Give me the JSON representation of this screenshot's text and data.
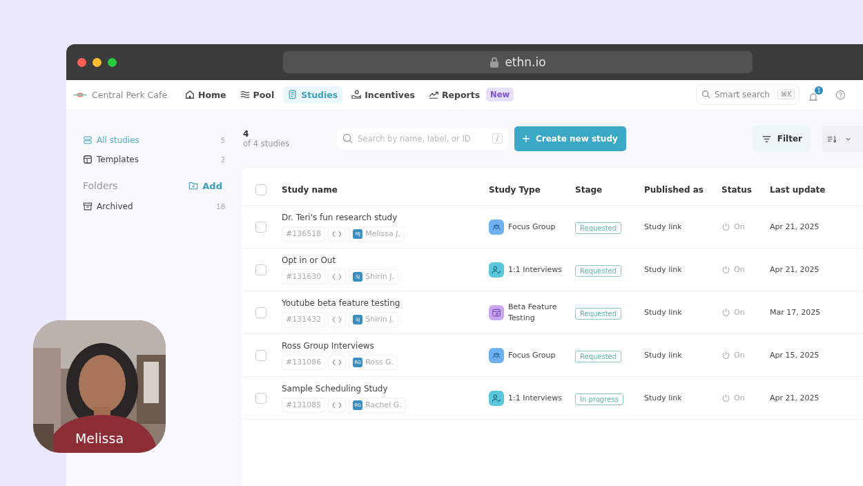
{
  "browser": {
    "url": "ethn.io"
  },
  "nav": {
    "brand": "Central Perk Cafe",
    "items": [
      {
        "label": "Home",
        "kind": "home",
        "selected": false
      },
      {
        "label": "Pool",
        "kind": "pool",
        "selected": false
      },
      {
        "label": "Studies",
        "kind": "studies",
        "selected": true
      },
      {
        "label": "Incentives",
        "kind": "incentives",
        "selected": false
      },
      {
        "label": "Reports",
        "kind": "reports",
        "selected": false,
        "badge": "New"
      }
    ],
    "search": {
      "placeholder": "Smart search",
      "shortcut": "⌘K"
    },
    "notifications": "1"
  },
  "sidebar": {
    "items": [
      {
        "label": "All studies",
        "count": "5",
        "kind": "stack",
        "selected": true
      },
      {
        "label": "Templates",
        "count": "2",
        "kind": "template",
        "selected": false
      }
    ],
    "folders_title": "Folders",
    "add": "Add",
    "folders": [
      {
        "label": "Archived",
        "count": "18"
      }
    ]
  },
  "summary": {
    "count": "4",
    "of": "of 4 studies"
  },
  "search": {
    "placeholder": "Search by name, label, or ID",
    "shortcut": "/"
  },
  "create_button": "Create new study",
  "filter_button": "Filter",
  "table": {
    "columns": [
      "Study name",
      "Study Type",
      "Stage",
      "Published as",
      "Status",
      "Last update"
    ],
    "all_checked": false,
    "rows": [
      {
        "checked": false,
        "name": "Dr. Teri's fun research study",
        "id": "#136518",
        "initials": "MJ",
        "owner": "Melissa J.",
        "kind": "focus",
        "type": "Focus Group",
        "stage": "Requested",
        "published": "Study link",
        "on": true,
        "status": "On",
        "updated": "Apr 21, 2025"
      },
      {
        "checked": false,
        "name": "Opt in or Out",
        "id": "#131630",
        "initials": "SJ",
        "owner": "Shirin J.",
        "kind": "interview",
        "type": "1:1 Interviews",
        "stage": "Requested",
        "published": "Study link",
        "on": true,
        "status": "On",
        "updated": "Apr 21, 2025"
      },
      {
        "checked": false,
        "name": "Youtube beta feature testing",
        "id": "#131432",
        "initials": "SJ",
        "owner": "Shirin J.",
        "kind": "beta",
        "type": "Beta Feature Testing",
        "stage": "Requested",
        "published": "Study link",
        "on": true,
        "status": "On",
        "updated": "Mar 17, 2025"
      },
      {
        "checked": false,
        "name": "Ross Group Interviews",
        "id": "#131086",
        "initials": "RG",
        "owner": "Ross G.",
        "kind": "focus",
        "type": "Focus Group",
        "stage": "Requested",
        "published": "Study link",
        "on": true,
        "status": "On",
        "updated": "Apr 15, 2025"
      },
      {
        "checked": false,
        "name": "Sample Scheduling Study",
        "id": "#131085",
        "initials": "RG",
        "owner": "Rachel G.",
        "kind": "interview",
        "type": "1:1 Interviews",
        "stage": "In progress",
        "published": "Study link",
        "on": true,
        "status": "On",
        "updated": "Apr 21, 2025"
      }
    ]
  },
  "video": {
    "kind": "picture",
    "caption": "Melissa"
  }
}
